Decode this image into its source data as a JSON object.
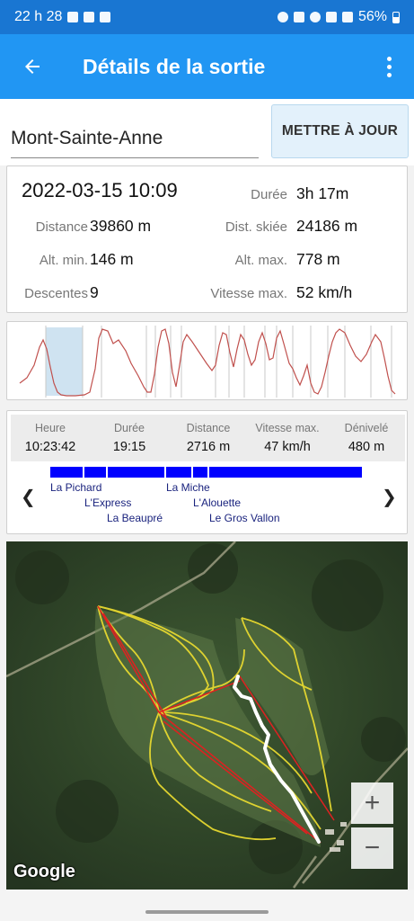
{
  "status_bar": {
    "time": "22 h 28",
    "battery": "56%"
  },
  "app_bar": {
    "title": "Détails de la sortie",
    "back_icon": "arrow-back-icon",
    "menu_icon": "more-vert-icon"
  },
  "outing": {
    "name": "Mont-Sainte-Anne",
    "update_label": "METTRE À JOUR"
  },
  "summary": {
    "datetime": "2022-03-15 10:09",
    "duration_label": "Durée",
    "duration": "3h 17m",
    "distance_label": "Distance",
    "distance": "39860 m",
    "ski_distance_label": "Dist. skiée",
    "ski_distance": "24186 m",
    "alt_min_label": "Alt. min.",
    "alt_min": "146 m",
    "alt_max_label": "Alt. max.",
    "alt_max": "778 m",
    "runs_label": "Descentes",
    "runs": "9",
    "speed_max_label": "Vitesse max.",
    "speed_max": "52 km/h"
  },
  "segment": {
    "headers": [
      "Heure",
      "Durée",
      "Distance",
      "Vitesse max.",
      "Dénivelé"
    ],
    "values": [
      "10:23:42",
      "19:15",
      "2716 m",
      "47 km/h",
      "480 m"
    ],
    "runs": [
      "La Pichard",
      "L'Express",
      "La Beaupré",
      "La Miche",
      "L'Alouette",
      "Le Gros Vallon"
    ],
    "prev_icon": "chevron-left-icon",
    "next_icon": "chevron-right-icon",
    "bar_color": "#0000ff"
  },
  "map": {
    "attribution": "Google",
    "zoom_in": "+",
    "zoom_out": "−"
  },
  "colors": {
    "accent": "#2196f3",
    "status": "#1976d2",
    "profile_line": "#c0504d",
    "track": "#ffffff",
    "lifts": "#d32f2f",
    "trails": "#e6d830"
  }
}
